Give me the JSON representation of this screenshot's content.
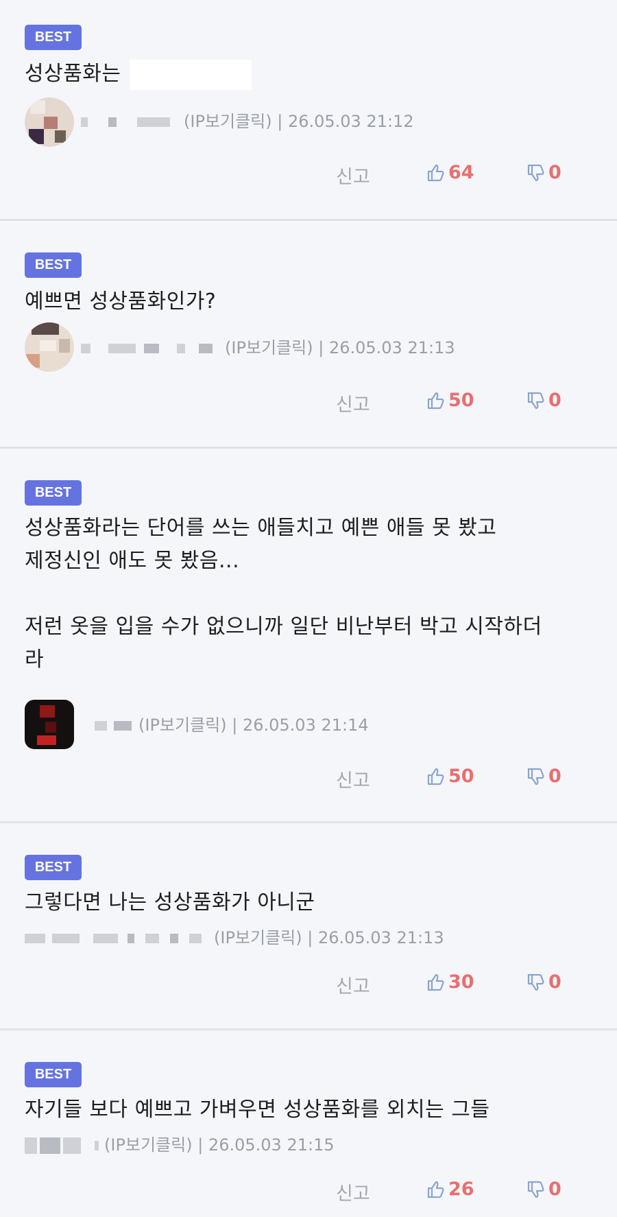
{
  "colors": {
    "badge": "#6573e0",
    "vote": "#e86f6f",
    "thumb_icon": "#8aa4cc",
    "divider": "#dfe2e8",
    "background": "#f4f6fa"
  },
  "comments": [
    {
      "badge": "BEST",
      "text": "성상품화는",
      "meta": "(IP보기클릭) | 26.05.03 21:12",
      "report": "신고",
      "up": "64",
      "down": "0"
    },
    {
      "badge": "BEST",
      "text": "예쁘면 성상품화인가?",
      "meta": "(IP보기클릭) | 26.05.03 21:13",
      "report": "신고",
      "up": "50",
      "down": "0"
    },
    {
      "badge": "BEST",
      "text": "성상품화라는 단어를 쓰는 애들치고 예쁜 애들 못 봤고\n제정신인 애도 못 봤음...\n\n저런 옷을 입을 수가 없으니까 일단 비난부터 박고 시작하더\n라",
      "meta": "(IP보기클릭) | 26.05.03 21:14",
      "report": "신고",
      "up": "50",
      "down": "0"
    },
    {
      "badge": "BEST",
      "text": "그렇다면 나는 성상품화가 아니군",
      "meta": "(IP보기클릭) | 26.05.03 21:13",
      "report": "신고",
      "up": "30",
      "down": "0"
    },
    {
      "badge": "BEST",
      "text": "자기들 보다 예쁘고 가벼우면 성상품화를 외치는 그들",
      "meta": "(IP보기클릭) | 26.05.03 21:15",
      "report": "신고",
      "up": "26",
      "down": "0"
    }
  ]
}
